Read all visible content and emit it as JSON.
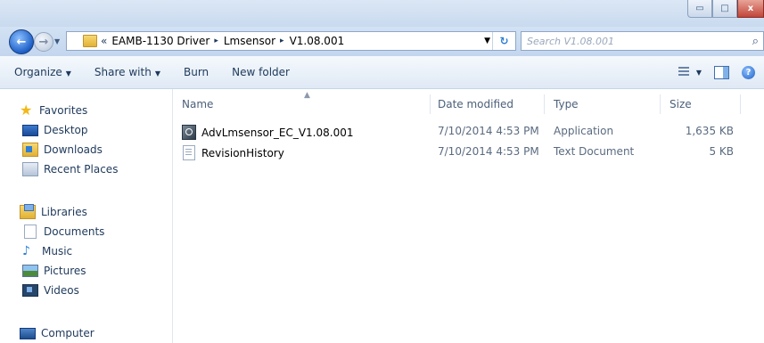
{
  "window": {
    "min_glyph": "▭",
    "max_glyph": "□",
    "close_glyph": "x"
  },
  "address": {
    "chevron": "«",
    "crumbs": [
      "EAMB-1130 Driver",
      "Lmsensor",
      "V1.08.001"
    ],
    "separator": "▸"
  },
  "search": {
    "placeholder": "Search V1.08.001"
  },
  "toolbar": {
    "organize": "Organize",
    "share_with": "Share with",
    "burn": "Burn",
    "new_folder": "New folder"
  },
  "sidebar": {
    "favorites": "Favorites",
    "favorites_items": [
      "Desktop",
      "Downloads",
      "Recent Places"
    ],
    "libraries": "Libraries",
    "libraries_items": [
      "Documents",
      "Music",
      "Pictures",
      "Videos"
    ],
    "computer": "Computer"
  },
  "columns": {
    "name": "Name",
    "date_modified": "Date modified",
    "type": "Type",
    "size": "Size"
  },
  "files": [
    {
      "name": "AdvLmsensor_EC_V1.08.001",
      "date": "7/10/2014 4:53 PM",
      "type": "Application",
      "size": "1,635 KB",
      "icon": "application-icon"
    },
    {
      "name": "RevisionHistory",
      "date": "7/10/2014 4:53 PM",
      "type": "Text Document",
      "size": "5 KB",
      "icon": "text-document-icon"
    }
  ],
  "colors": {
    "accent": "#1e395b",
    "chrome": "#d3e2f4"
  }
}
